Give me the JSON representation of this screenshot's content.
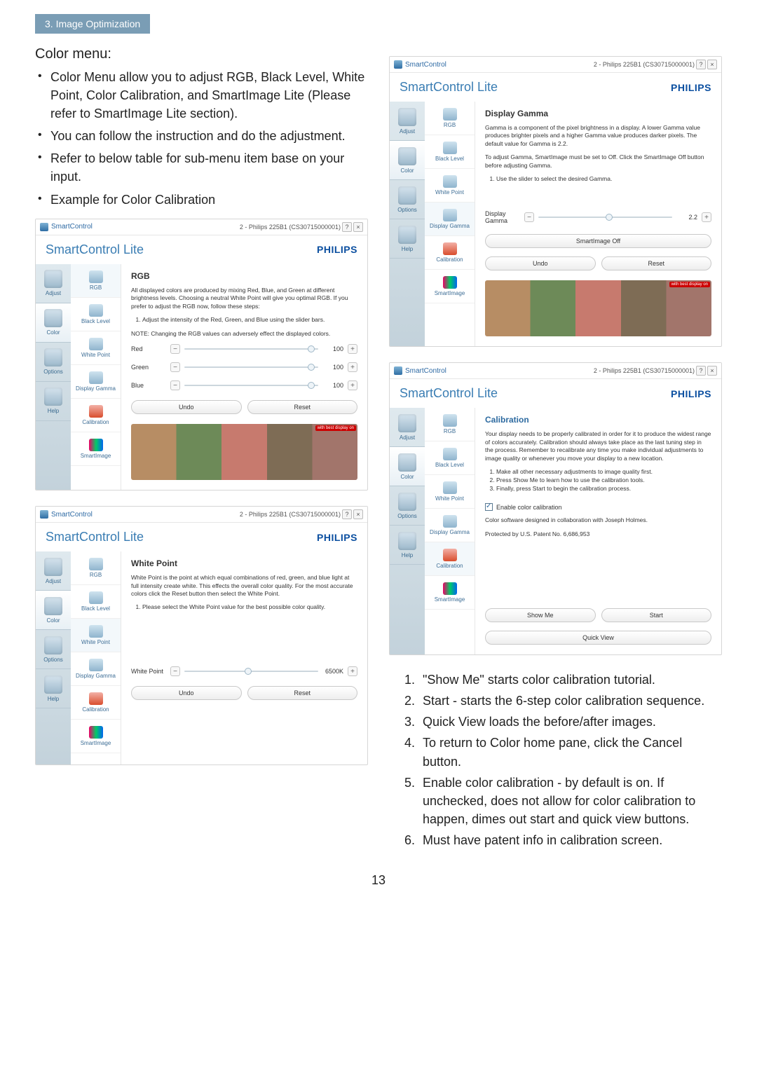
{
  "breadcrumb": "3. Image Optimization",
  "color_heading": "Color menu:",
  "bullets": [
    "Color Menu allow you to adjust RGB, Black Level, White Point, Color Calibration, and SmartImage Lite (Please refer to SmartImage Lite section).",
    "You can follow the instruction and do the adjustment.",
    "Refer to below table for sub-menu item base on your input.",
    "Example for Color Calibration"
  ],
  "numbered": [
    "\"Show Me\" starts color calibration tutorial.",
    "Start - starts the 6-step color calibration sequence.",
    "Quick View loads the before/after images.",
    "To return to Color home pane, click the Cancel button.",
    "Enable color calibration - by default is on. If unchecked, does not allow for color calibration to happen, dimes out start and quick view buttons.",
    "Must have patent info in calibration screen."
  ],
  "page_number": "13",
  "brand": {
    "app_title": "SmartControl",
    "app_subtitle": "SmartControl Lite",
    "logo": "PHILIPS",
    "model_info": "2 - Philips 225B1 (CS30715000001)"
  },
  "side_nav": {
    "adjust": "Adjust",
    "color": "Color",
    "options": "Options",
    "help": "Help"
  },
  "sub_nav": {
    "rgb": "RGB",
    "black_level": "Black Level",
    "white_point": "White Point",
    "display_gamma": "Display Gamma",
    "calibration": "Calibration",
    "smartimage": "SmartImage"
  },
  "rgb_panel": {
    "title": "RGB",
    "desc": "All displayed colors are produced by mixing Red, Blue, and Green at different brightness levels. Choosing a neutral White Point will give you optimal RGB. If you prefer to adjust the RGB now, follow these steps:",
    "step1": "Adjust the intensity of the Red, Green, and Blue using the slider bars.",
    "note": "NOTE: Changing the RGB values can adversely effect the displayed colors.",
    "red": {
      "label": "Red",
      "value": "100"
    },
    "green": {
      "label": "Green",
      "value": "100"
    },
    "blue": {
      "label": "Blue",
      "value": "100"
    },
    "undo": "Undo",
    "reset": "Reset"
  },
  "wp_panel": {
    "title": "White Point",
    "desc": "White Point is the point at which equal combinations of red, green, and blue light at full intensity create white. This effects the overall color quality. For the most accurate colors click the Reset button then select the White Point.",
    "step1": "Please select the White Point value for the best possible color quality.",
    "label": "White Point",
    "value": "6500K",
    "undo": "Undo",
    "reset": "Reset"
  },
  "gamma_panel": {
    "title": "Display Gamma",
    "desc": "Gamma is a component of the pixel brightness in a display. A lower Gamma value produces brighter pixels and a higher Gamma value produces darker pixels. The default value for Gamma is 2.2.",
    "desc2": "To adjust Gamma, SmartImage must be set to Off. Click the SmartImage Off button before adjusting Gamma.",
    "step1": "Use the slider to select the desired Gamma.",
    "label": "Display Gamma",
    "value": "2.2",
    "si_off": "SmartImage Off",
    "undo": "Undo",
    "reset": "Reset"
  },
  "calib_panel": {
    "title": "Calibration",
    "desc_line1": "Your display needs to be properly calibrated in order for it to produce the widest range of colors accurately. Calibration should always take place as the last tuning step in the process. Remember to recalibrate any time you make individual adjustments to image quality or whenever you move your display to a new location.",
    "step1": "Make all other necessary adjustments to image quality first.",
    "step2": "Press Show Me to learn how to use the calibration tools.",
    "step3": "Finally, press Start to begin the calibration process.",
    "enable": "Enable color calibration",
    "credits": "Color software designed in collaboration with Joseph Holmes.",
    "patent": "Protected by U.S. Patent No. 6,686,953",
    "show_me": "Show Me",
    "start": "Start",
    "quick_view": "Quick View"
  }
}
